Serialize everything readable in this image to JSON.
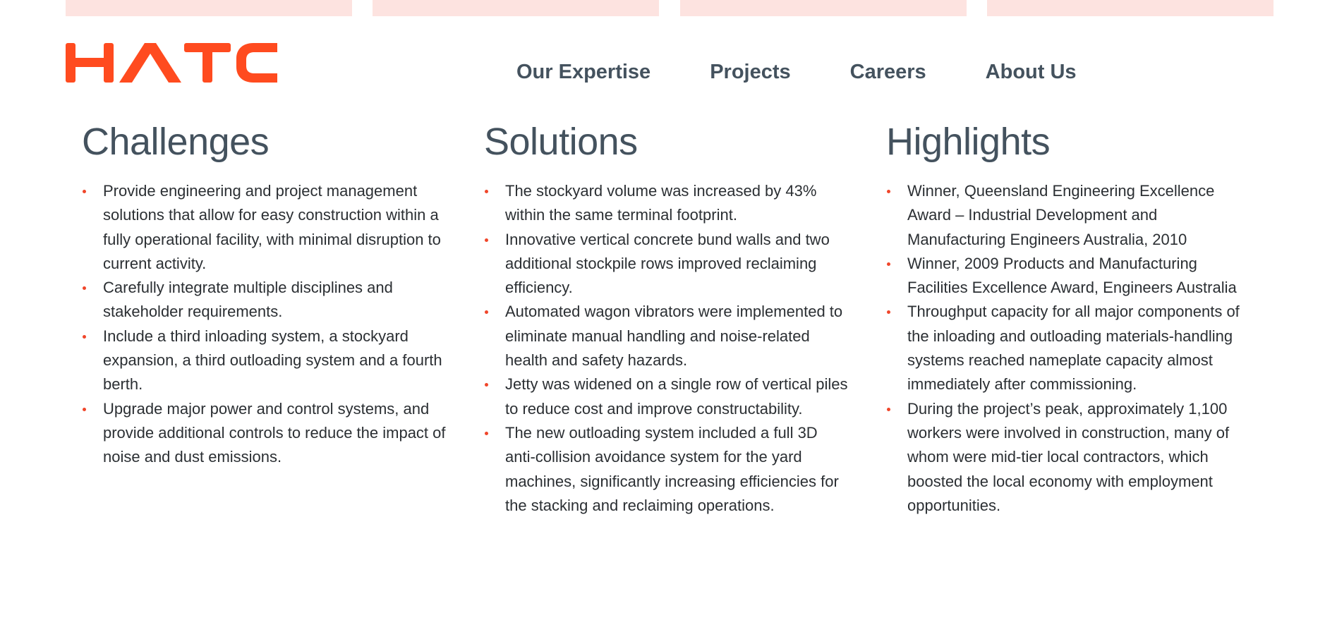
{
  "brand": {
    "logo_text": "HATCH",
    "logo_color": "#ff4b1f"
  },
  "nav": {
    "items": [
      {
        "label": "Our Expertise"
      },
      {
        "label": "Projects"
      },
      {
        "label": "Careers"
      },
      {
        "label": "About Us"
      }
    ]
  },
  "sections": [
    {
      "title": "Challenges",
      "items": [
        "Provide engineering and project management solutions that allow for easy construction within a fully operational facility, with minimal disruption to current activity.",
        "Carefully integrate multiple disciplines and stakeholder requirements.",
        "Include a third inloading system, a stockyard expansion, a third outloading system and a fourth berth.",
        "Upgrade major power and control systems, and provide additional controls to reduce the impact of noise and dust emissions."
      ]
    },
    {
      "title": "Solutions",
      "items": [
        "The stockyard volume was increased by 43% within the same terminal footprint.",
        "Innovative vertical concrete bund walls and two additional stockpile rows improved reclaiming efficiency.",
        "Automated wagon vibrators were implemented to eliminate manual handling and noise-related health and safety hazards.",
        "Jetty was widened on a single row of vertical piles to reduce cost and improve constructability.",
        "The new outloading system included a full 3D anti-collision avoidance system for the yard machines, significantly increasing efficiencies for the stacking and reclaiming operations."
      ]
    },
    {
      "title": "Highlights",
      "items": [
        "Winner, Queensland Engineering Excellence Award – Industrial Development and Manufacturing Engineers Australia, 2010",
        "Winner, 2009 Products and Manufacturing Facilities Excellence Award, Engineers Australia",
        "Throughput capacity for all major components of the inloading and outloading materials-handling systems reached nameplate capacity almost immediately after commissioning.",
        "During the project’s peak, approximately 1,100 workers were involved in construction, many of whom were mid-tier local contractors, which boosted the local economy with employment opportunities."
      ]
    }
  ],
  "colors": {
    "accent": "#f0462a",
    "heading": "#44525e",
    "body_text": "#2b2f33",
    "top_bar": "#fde3e0"
  }
}
